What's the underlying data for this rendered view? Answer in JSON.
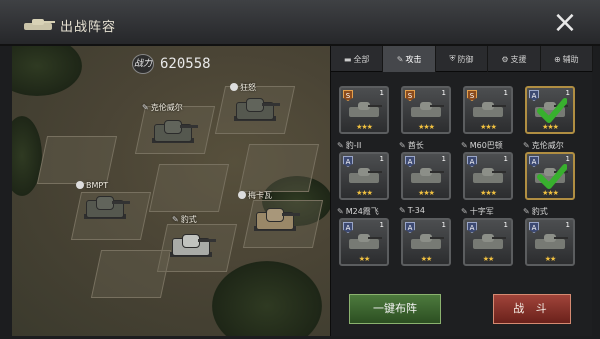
{
  "window": {
    "title": "出战阵容",
    "close_icon": "×"
  },
  "formation": {
    "power_badge": "战力",
    "power_value": "620558",
    "units": [
      {
        "name": "克伦威尔",
        "marker": "wrench"
      },
      {
        "name": "狂怒",
        "marker": "shield"
      },
      {
        "name": "BMPT",
        "marker": "circle"
      },
      {
        "name": "豹式",
        "marker": "wrench"
      },
      {
        "name": "梅卡瓦",
        "marker": "shield"
      }
    ]
  },
  "tabs": [
    {
      "label": "全部",
      "icon": "tank-icon",
      "active": false
    },
    {
      "label": "攻击",
      "icon": "wrench-icon",
      "active": true
    },
    {
      "label": "防御",
      "icon": "shield-icon",
      "active": false
    },
    {
      "label": "支援",
      "icon": "gear-icon",
      "active": false
    },
    {
      "label": "辅助",
      "icon": "plus-icon",
      "active": false
    }
  ],
  "card_rows": [
    {
      "labels": [],
      "cards": [
        {
          "rank": "S",
          "level": "1",
          "stars": "★★★",
          "selected": false
        },
        {
          "rank": "S",
          "level": "1",
          "stars": "★★★",
          "selected": false
        },
        {
          "rank": "S",
          "level": "1",
          "stars": "★★★",
          "selected": false
        },
        {
          "rank": "A",
          "level": "1",
          "stars": "★★★",
          "selected": true
        }
      ]
    },
    {
      "labels": [
        "豹-II",
        "酋长",
        "M60巴顿",
        "克伦威尔"
      ],
      "cards": [
        {
          "rank": "A",
          "level": "1",
          "stars": "★★★",
          "selected": false
        },
        {
          "rank": "A",
          "level": "1",
          "stars": "★★★",
          "selected": false
        },
        {
          "rank": "A",
          "level": "1",
          "stars": "★★★",
          "selected": false
        },
        {
          "rank": "A",
          "level": "1",
          "stars": "★★★",
          "selected": true
        }
      ]
    },
    {
      "labels": [
        "M24霞飞",
        "T-34",
        "十字军",
        "豹式"
      ],
      "cards": [
        {
          "rank": "A",
          "level": "1",
          "stars": "★★",
          "selected": false
        },
        {
          "rank": "A",
          "level": "1",
          "stars": "★★",
          "selected": false
        },
        {
          "rank": "A",
          "level": "1",
          "stars": "★★",
          "selected": false
        },
        {
          "rank": "A",
          "level": "1",
          "stars": "★★",
          "selected": false
        }
      ]
    }
  ],
  "actions": {
    "auto_deploy": "一键布阵",
    "battle": "战 斗"
  },
  "colors": {
    "accent_green": "#4d7a3d",
    "accent_red": "#a1443a",
    "check_green": "#38b02e",
    "gold_border": "#b08e42"
  }
}
